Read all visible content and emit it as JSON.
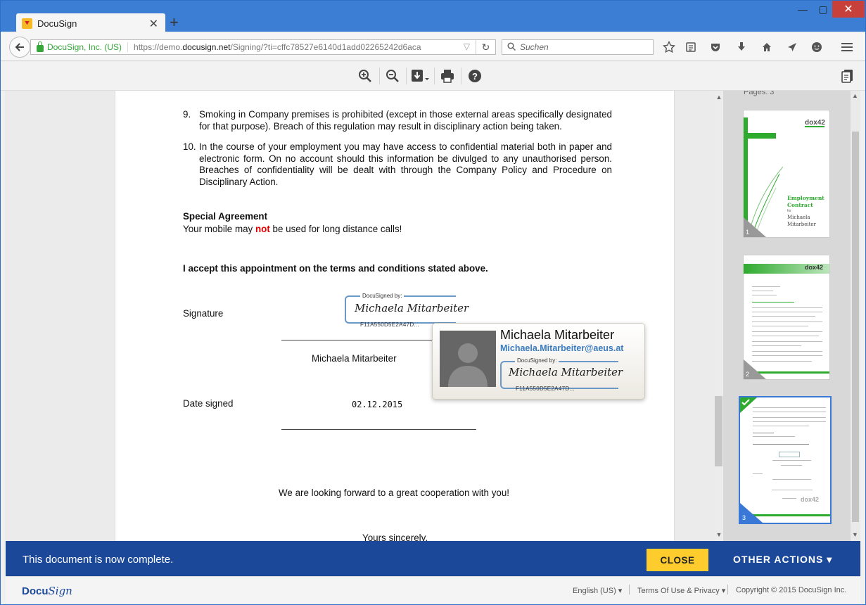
{
  "browser": {
    "tab_title": "DocuSign",
    "new_tab": "+",
    "close_tab": "✕",
    "window_controls": {
      "minimize": "—",
      "maximize": "▢",
      "close": "✕"
    },
    "url_identity": "DocuSign, Inc. (US)",
    "url_prefix": "https://demo.",
    "url_domain": "docusign.net",
    "url_path": "/Signing/?ti=cffc78527e6140d1add02265242d6aca",
    "search_placeholder": "Suchen",
    "toolbar_icons": [
      "star-icon",
      "reading-list-icon",
      "pocket-icon",
      "download-icon",
      "home-icon",
      "send-icon",
      "emoji-icon",
      "menu-icon"
    ]
  },
  "viewer_toolbar": {
    "icons": [
      "zoom-in-icon",
      "zoom-out-icon",
      "download-icon",
      "print-icon",
      "help-icon"
    ],
    "help_glyph": "?"
  },
  "document": {
    "item9_num": "9.",
    "item9_text": "Smoking in Company premises is prohibited (except in those external areas specifically designated for that purpose). Breach of this regulation may result in disciplinary action being taken.",
    "item10_num": "10.",
    "item10_text": "In the course of your employment you may have access to confidential material both in paper and electronic form. On no account should this information be divulged to any unauthorised person. Breaches of confidentiality will be dealt with through the Company Policy and Procedure on Disciplinary Action.",
    "special_heading": "Special Agreement",
    "special_pre": "Your mobile may ",
    "special_not": "not",
    "special_post": " be used for long distance calls!",
    "accept_text": "I accept this appointment on the terms and conditions stated above.",
    "signature_label": "Signature",
    "docusigned_by": "DocuSigned by:",
    "signature_script": "Michaela Mitarbeiter",
    "signature_id": "F11A550D5E2A47D...",
    "signer_name": "Michaela Mitarbeiter",
    "date_label": "Date signed",
    "date_value": "02.12.2015",
    "closing": "We are looking forward to a great cooperation with you!",
    "yours": "Yours sincerely,"
  },
  "signer_popup": {
    "name": "Michaela Mitarbeiter",
    "email": "Michaela.Mitarbeiter@aeus.at",
    "docusigned_by": "DocuSigned by:",
    "signature_script": "Michaela Mitarbeiter",
    "signature_id": "F11A550D5E2A47D..."
  },
  "thumbnails": {
    "pages_label": "Pages: 3",
    "pages": [
      {
        "number": "1",
        "logo": "dox42",
        "title_line1": "Employment",
        "title_line2": "Contract",
        "for": "for",
        "name_line1": "Michaela",
        "name_line2": "Mitarbeiter"
      },
      {
        "number": "2",
        "logo": "dox42"
      },
      {
        "number": "3",
        "logo": "dox42",
        "status": "completed"
      }
    ]
  },
  "banner": {
    "message": "This document is now complete.",
    "close_label": "CLOSE",
    "other_actions_label": "OTHER ACTIONS ▾"
  },
  "footer": {
    "logo_text_a": "Docu",
    "logo_text_b": "Sign",
    "language": "English (US) ▾",
    "terms": "Terms Of Use & Privacy ▾",
    "copyright": "Copyright © 2015 DocuSign Inc."
  },
  "colors": {
    "browser_blue": "#3c7ed4",
    "banner_blue": "#1b4899",
    "close_yellow": "#fecc2c",
    "link_blue": "#3a7bbf",
    "thumb_green": "#2eaa2e",
    "selected_blue": "#3a78d8"
  }
}
